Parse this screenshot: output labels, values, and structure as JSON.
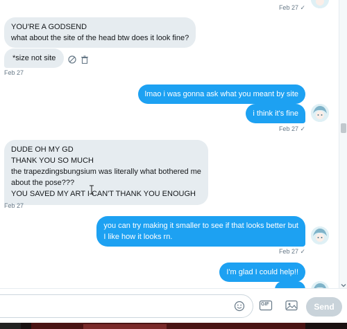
{
  "conversation": {
    "top_meta": "Feb 27 ✓",
    "messages": [
      {
        "dir": "in",
        "lines": [
          "YOU'RE A GODSEND",
          "what about the site of the head btw does it look fine?"
        ]
      },
      {
        "dir": "in",
        "lines": [
          "*size not site"
        ]
      },
      {
        "meta": "Feb 27"
      },
      {
        "dir": "out",
        "lines": [
          "lmao i was gonna ask what you meant by site"
        ]
      },
      {
        "dir": "out",
        "lines": [
          "i think it's fine"
        ]
      },
      {
        "meta": "Feb 27 ✓"
      },
      {
        "dir": "in",
        "lines": [
          "DUDE OH MY GD",
          "THANK YOU SO MUCH",
          "the trapezdingsbungsium was literally what bothered me",
          "about the pose???",
          "YOU SAVED MY ART I CAN'T THANK YOU ENOUGH"
        ]
      },
      {
        "meta": "Feb 27"
      },
      {
        "dir": "out",
        "lines": [
          "you can try making it smaller to see if that looks better but",
          "I like how it looks rn."
        ]
      },
      {
        "meta": "Feb 27 ✓"
      },
      {
        "dir": "out",
        "lines": [
          "I'm glad I could help!!"
        ]
      }
    ]
  },
  "composer": {
    "placeholder": "",
    "gif_label": "GIF",
    "send_label": "Send"
  },
  "colors": {
    "accent": "#1da1f2",
    "incoming_bubble": "#e6ecf0",
    "meta_text": "#657786",
    "send_disabled": "#c9d3da"
  },
  "icons": [
    "emoji-icon",
    "gif-icon",
    "image-icon",
    "mute-icon",
    "trash-icon",
    "chevron-down-icon",
    "avatar"
  ]
}
